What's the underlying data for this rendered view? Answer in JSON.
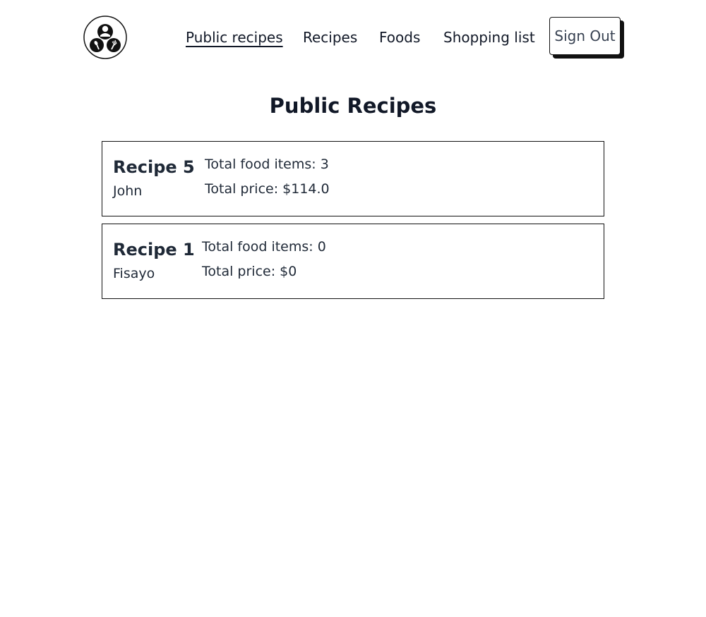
{
  "nav": {
    "logo_icon": "chef-logo-icon",
    "links": [
      {
        "label": "Public recipes",
        "active": true
      },
      {
        "label": "Recipes",
        "active": false
      },
      {
        "label": "Foods",
        "active": false
      },
      {
        "label": "Shopping list",
        "active": false
      }
    ],
    "signout_label": "Sign Out"
  },
  "page": {
    "title": "Public Recipes"
  },
  "recipes": [
    {
      "name": "Recipe 5",
      "author": "John",
      "total_items": "Total food items: 3",
      "total_price": "Total price: $114.0"
    },
    {
      "name": "Recipe 1",
      "author": "Fisayo",
      "total_items": "Total food items: 0",
      "total_price": "Total price: $0"
    }
  ]
}
